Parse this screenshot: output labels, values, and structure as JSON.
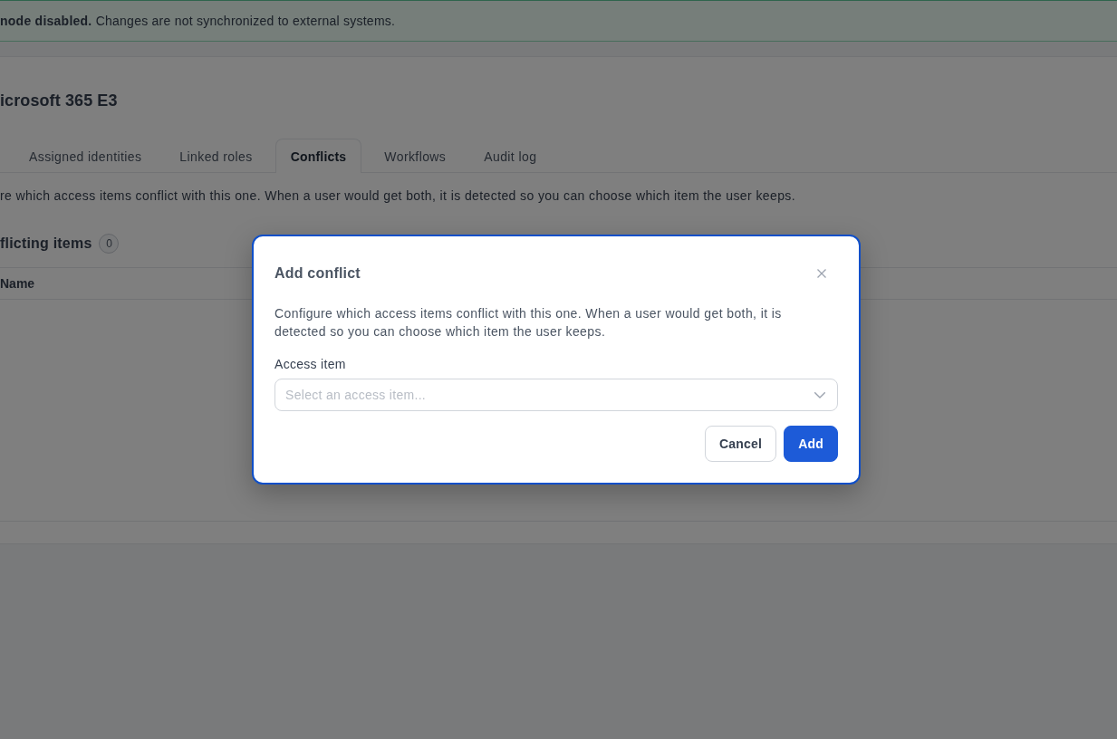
{
  "banner": {
    "message": "**node disabled.** Changes are not synchronized to external systems."
  },
  "page": {
    "title": "icrosoft 365 E3",
    "tabs": [
      {
        "label": "Assigned identities",
        "selected": false
      },
      {
        "label": "Linked roles",
        "selected": false
      },
      {
        "label": "Conflicts",
        "selected": true
      },
      {
        "label": "Workflows",
        "selected": false
      },
      {
        "label": "Audit log",
        "selected": false
      }
    ],
    "description": "re which access items conflict with this one. When a user would get both, it is detected so you can choose which item the user keeps.",
    "section": {
      "title": "flicting items",
      "count": "0"
    },
    "table": {
      "columns": [
        "Name"
      ]
    }
  },
  "dialog": {
    "title": "Add conflict",
    "description": "Configure which access items conflict with this one. When a user would get both, it is detected so you can choose which item the user keeps.",
    "field": {
      "label": "Access item",
      "placeholder": "Select an access item..."
    },
    "buttons": [
      {
        "label": "Cancel",
        "kind": "secondary"
      },
      {
        "label": "Add",
        "kind": "primary"
      }
    ]
  }
}
